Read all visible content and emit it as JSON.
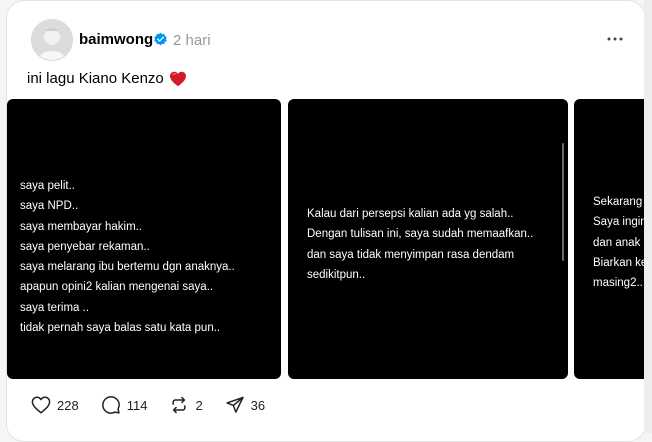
{
  "post": {
    "username": "baimwong",
    "time": "2 hari",
    "caption": "ini lagu Kiano Kenzo",
    "caption_emoji": "heart-red-icon"
  },
  "slides": [
    {
      "lines": [
        "saya pelit..",
        "saya NPD..",
        "saya membayar hakim..",
        "saya penyebar rekaman..",
        "saya melarang ibu bertemu dgn anaknya..",
        "apapun opini2 kalian mengenai saya..",
        "saya terima ..",
        "tidak pernah saya balas satu kata pun.."
      ]
    },
    {
      "lines": [
        "Kalau dari persepsi kalian ada yg salah..",
        "Dengan tulisan ini, saya sudah memaafkan..",
        "dan saya tidak menyimpan rasa dendam",
        "sedikitpun.."
      ]
    },
    {
      "lines": [
        "Sekarang",
        "Saya ingin",
        "dan anak",
        "Biarkan ke",
        "masing2.."
      ]
    }
  ],
  "actions": {
    "likes": "228",
    "replies": "114",
    "reposts": "2",
    "shares": "36"
  },
  "colors": {
    "accent_verified": "#0095f6",
    "heart": "#e0245e",
    "slide_bg": "#000000"
  }
}
